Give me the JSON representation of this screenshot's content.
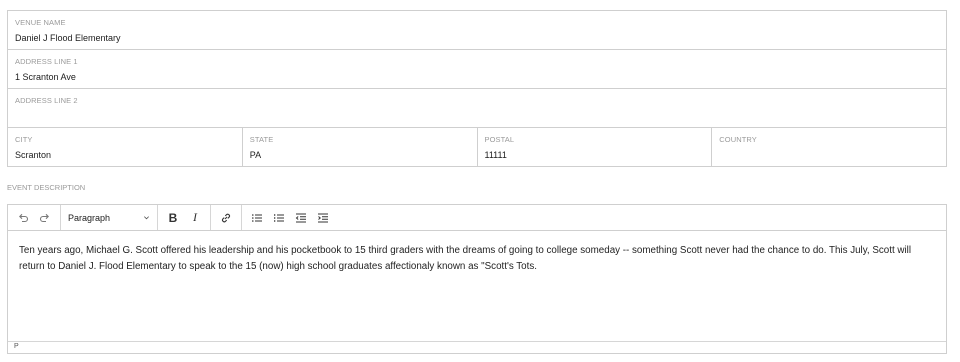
{
  "venue": {
    "name_label": "VENUE NAME",
    "name_value": "Daniel J Flood Elementary",
    "addr1_label": "ADDRESS LINE 1",
    "addr1_value": "1 Scranton Ave",
    "addr2_label": "ADDRESS LINE 2",
    "addr2_value": "",
    "city_label": "CITY",
    "city_value": "Scranton",
    "state_label": "STATE",
    "state_value": "PA",
    "postal_label": "POSTAL",
    "postal_value": "11111",
    "country_label": "COUNTRY",
    "country_value": ""
  },
  "description": {
    "label": "EVENT DESCRIPTION",
    "toolbar": {
      "undo_icon": "undo-icon",
      "redo_icon": "redo-icon",
      "block_format": "Paragraph",
      "bold_label": "B",
      "italic_label": "I",
      "link_icon": "link-icon",
      "bullet_list_icon": "bullet-list-icon",
      "numbered_list_icon": "numbered-list-icon",
      "outdent_icon": "outdent-icon",
      "indent_icon": "indent-icon"
    },
    "body": "Ten years ago, Michael G. Scott offered his leadership and his pocketbook to 15 third graders with the dreams of going to college someday -- something Scott never had the chance to do. This July, Scott will return to Daniel J. Flood Elementary to speak to the 15 (now) high school graduates affectionaly known as \"Scott's Tots.",
    "status_path": "P"
  }
}
